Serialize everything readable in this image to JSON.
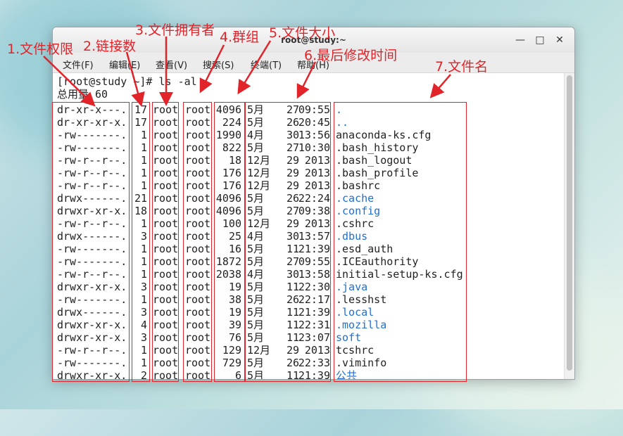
{
  "window": {
    "title": "root@study:~"
  },
  "menu": [
    {
      "label": "文件(F)"
    },
    {
      "label": "编辑(E)"
    },
    {
      "label": "查看(V)"
    },
    {
      "label": "搜索(S)"
    },
    {
      "label": "终端(T)"
    },
    {
      "label": "帮助(H)"
    }
  ],
  "terminal": {
    "prompt": "[root@study ~]# ls -al",
    "total": "总用量 60",
    "rows": [
      {
        "perm": "dr-xr-x---.",
        "links": "17",
        "owner": "root",
        "group": "root",
        "size": "4096",
        "month": "5月",
        "day": "27",
        "time": "09:55",
        "name": ".",
        "dir": true
      },
      {
        "perm": "dr-xr-xr-x.",
        "links": "17",
        "owner": "root",
        "group": "root",
        "size": "224",
        "month": "5月",
        "day": "26",
        "time": "20:45",
        "name": "..",
        "dir": true
      },
      {
        "perm": "-rw-------.",
        "links": "1",
        "owner": "root",
        "group": "root",
        "size": "1990",
        "month": "4月",
        "day": "30",
        "time": "13:56",
        "name": "anaconda-ks.cfg",
        "dir": false
      },
      {
        "perm": "-rw-------.",
        "links": "1",
        "owner": "root",
        "group": "root",
        "size": "822",
        "month": "5月",
        "day": "27",
        "time": "10:30",
        "name": ".bash_history",
        "dir": false
      },
      {
        "perm": "-rw-r--r--.",
        "links": "1",
        "owner": "root",
        "group": "root",
        "size": "18",
        "month": "12月",
        "day": "29",
        "time": "2013",
        "name": ".bash_logout",
        "dir": false
      },
      {
        "perm": "-rw-r--r--.",
        "links": "1",
        "owner": "root",
        "group": "root",
        "size": "176",
        "month": "12月",
        "day": "29",
        "time": "2013",
        "name": ".bash_profile",
        "dir": false
      },
      {
        "perm": "-rw-r--r--.",
        "links": "1",
        "owner": "root",
        "group": "root",
        "size": "176",
        "month": "12月",
        "day": "29",
        "time": "2013",
        "name": ".bashrc",
        "dir": false
      },
      {
        "perm": "drwx------.",
        "links": "21",
        "owner": "root",
        "group": "root",
        "size": "4096",
        "month": "5月",
        "day": "26",
        "time": "22:24",
        "name": ".cache",
        "dir": true
      },
      {
        "perm": "drwxr-xr-x.",
        "links": "18",
        "owner": "root",
        "group": "root",
        "size": "4096",
        "month": "5月",
        "day": "27",
        "time": "09:38",
        "name": ".config",
        "dir": true
      },
      {
        "perm": "-rw-r--r--.",
        "links": "1",
        "owner": "root",
        "group": "root",
        "size": "100",
        "month": "12月",
        "day": "29",
        "time": "2013",
        "name": ".cshrc",
        "dir": false
      },
      {
        "perm": "drwx------.",
        "links": "3",
        "owner": "root",
        "group": "root",
        "size": "25",
        "month": "4月",
        "day": "30",
        "time": "13:57",
        "name": ".dbus",
        "dir": true
      },
      {
        "perm": "-rw-------.",
        "links": "1",
        "owner": "root",
        "group": "root",
        "size": "16",
        "month": "5月",
        "day": "11",
        "time": "21:39",
        "name": ".esd_auth",
        "dir": false
      },
      {
        "perm": "-rw-------.",
        "links": "1",
        "owner": "root",
        "group": "root",
        "size": "1872",
        "month": "5月",
        "day": "27",
        "time": "09:55",
        "name": ".ICEauthority",
        "dir": false
      },
      {
        "perm": "-rw-r--r--.",
        "links": "1",
        "owner": "root",
        "group": "root",
        "size": "2038",
        "month": "4月",
        "day": "30",
        "time": "13:58",
        "name": "initial-setup-ks.cfg",
        "dir": false
      },
      {
        "perm": "drwxr-xr-x.",
        "links": "3",
        "owner": "root",
        "group": "root",
        "size": "19",
        "month": "5月",
        "day": "11",
        "time": "22:30",
        "name": ".java",
        "dir": true
      },
      {
        "perm": "-rw-------.",
        "links": "1",
        "owner": "root",
        "group": "root",
        "size": "38",
        "month": "5月",
        "day": "26",
        "time": "22:17",
        "name": ".lesshst",
        "dir": false
      },
      {
        "perm": "drwx------.",
        "links": "3",
        "owner": "root",
        "group": "root",
        "size": "19",
        "month": "5月",
        "day": "11",
        "time": "21:39",
        "name": ".local",
        "dir": true
      },
      {
        "perm": "drwxr-xr-x.",
        "links": "4",
        "owner": "root",
        "group": "root",
        "size": "39",
        "month": "5月",
        "day": "11",
        "time": "22:31",
        "name": ".mozilla",
        "dir": true
      },
      {
        "perm": "drwxr-xr-x.",
        "links": "3",
        "owner": "root",
        "group": "root",
        "size": "76",
        "month": "5月",
        "day": "11",
        "time": "23:07",
        "name": "soft",
        "dir": true
      },
      {
        "perm": "-rw-r--r--.",
        "links": "1",
        "owner": "root",
        "group": "root",
        "size": "129",
        "month": "12月",
        "day": "29",
        "time": "2013",
        "name": "tcshrc",
        "dir": false
      },
      {
        "perm": "-rw-------.",
        "links": "1",
        "owner": "root",
        "group": "root",
        "size": "729",
        "month": "5月",
        "day": "26",
        "time": "22:33",
        "name": ".viminfo",
        "dir": false
      },
      {
        "perm": "drwxr-xr-x.",
        "links": "2",
        "owner": "root",
        "group": "root",
        "size": "6",
        "month": "5月",
        "day": "11",
        "time": "21:39",
        "name": "公共",
        "dir": true
      }
    ]
  },
  "annotations": [
    {
      "label": "1.文件权限"
    },
    {
      "label": "2.链接数"
    },
    {
      "label": "3.文件拥有者"
    },
    {
      "label": "4.群组"
    },
    {
      "label": "5.文件大小"
    },
    {
      "label": "6.最后修改时间"
    },
    {
      "label": "7.文件名"
    }
  ],
  "colors": {
    "annotation": "#e0242a",
    "directory": "#1f6fd0"
  }
}
